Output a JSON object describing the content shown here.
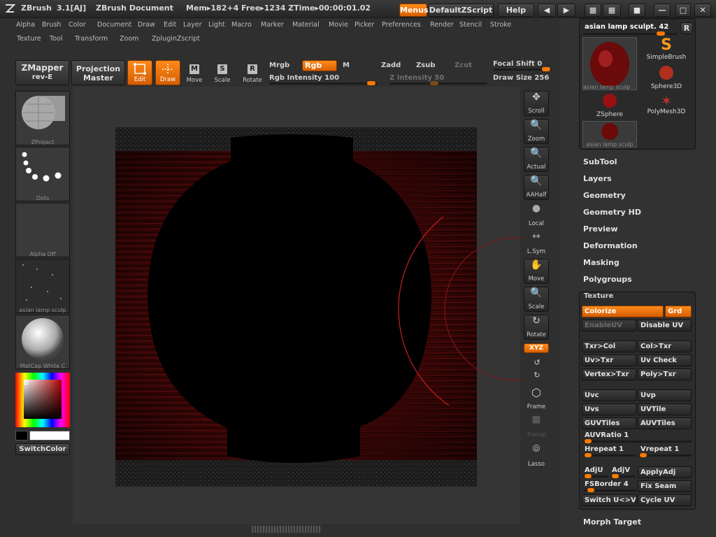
{
  "titlebar": {
    "app_name": "ZBrush",
    "version": "3.1[AJ]",
    "document": "ZBrush Document",
    "mem": "Mem▸182+4 Free▸1234 ZTime▸00:00:01.02",
    "menus_btn": "Menus",
    "script_btn": "DefaultZScript",
    "help_btn": "Help"
  },
  "menus": {
    "row1": [
      "Alpha",
      "Brush",
      "Color",
      "Document",
      "Draw",
      "Edit",
      "Layer",
      "Light",
      "Macro",
      "Marker",
      "Material",
      "Movie",
      "Picker",
      "Preferences",
      "Render",
      "Stencil",
      "Stroke"
    ],
    "row2": [
      "Texture",
      "Tool",
      "Transform",
      "Zoom",
      "Zplugin",
      "Zscript"
    ]
  },
  "toolbar": {
    "zmapper": "ZMapper",
    "zmapper2": "rev-E",
    "projection": "Projection",
    "projection2": "Master",
    "edit": "Edit",
    "draw": "Draw",
    "move": "Move",
    "scale": "Scale",
    "rotate": "Rotate",
    "move_letter": "M",
    "scale_letter": "S",
    "rotate_letter": "R",
    "mrgb": "Mrgb",
    "rgb": "Rgb",
    "m": "M",
    "rgb_intensity": "Rgb Intensity 100",
    "rgb_intensity_value": 100,
    "zadd": "Zadd",
    "zsub": "Zsub",
    "zcut": "Zcut",
    "z_intensity": "Z Intensity 50",
    "z_intensity_value": 50,
    "focal_shift": "Focal Shift 0",
    "focal_shift_value": 0,
    "draw_size": "Draw Size 256",
    "draw_size_value": 256
  },
  "left_shelf": {
    "items": [
      "ZProject",
      "Dots",
      "Alpha Off",
      "asian lamp sculp",
      "MatCap White C"
    ],
    "switch_color": "SwitchColor"
  },
  "right_shelf": {
    "scroll": "Scroll",
    "zoom": "Zoom",
    "actual": "Actual",
    "aahalf": "AAHalf",
    "local": "Local",
    "lsym": "L.Sym",
    "move": "Move",
    "scale": "Scale",
    "rotate": "Rotate",
    "xyz": "XYZ",
    "frame": "Frame",
    "transp": "Transp",
    "lasso": "Lasso"
  },
  "tool_popup": {
    "title": "asian lamp sculpt. 42",
    "r_btn": "R",
    "tools": [
      "asian lamp sculp",
      "SimpleBrush",
      "Sphere3D",
      "ZSphere",
      "PolyMesh3D",
      "asian lamp sculp"
    ]
  },
  "panel_sections": [
    "SubTool",
    "Layers",
    "Geometry",
    "Geometry HD",
    "Preview",
    "Deformation",
    "Masking",
    "Polygroups"
  ],
  "texture": {
    "title": "Texture",
    "colorize": "Colorize",
    "grd": "Grd",
    "enableuv": "EnableUV",
    "disableuv": "Disable UV",
    "txr_col": "Txr>Col",
    "col_txr": "Col>Txr",
    "uv_txr": "Uv>Txr",
    "uv_check": "Uv Check",
    "vertex_txr": "Vertex>Txr",
    "poly_txr": "Poly>Txr",
    "uvc": "Uvc",
    "uvp": "Uvp",
    "uvs": "Uvs",
    "uvtile": "UVTile",
    "guvtiles": "GUVTiles",
    "auvtiles": "AUVTiles",
    "auvratio": "AUVRatio 1",
    "auvratio_value": 1,
    "hrepeat": "Hrepeat 1",
    "hrepeat_value": 1,
    "vrepeat": "Vrepeat 1",
    "vrepeat_value": 1,
    "adju": "AdjU",
    "adjv": "AdjV",
    "applyadj": "ApplyAdj",
    "fsborder": "FSBorder 4",
    "fsborder_value": 4,
    "fixseam": "Fix Seam",
    "switchuv": "Switch U<>V",
    "cycleuv": "Cycle UV"
  },
  "morph_target": "Morph Target",
  "colors": {
    "accent": "#ff7a00",
    "bg": "#2f2f2f",
    "panel": "#323232"
  }
}
